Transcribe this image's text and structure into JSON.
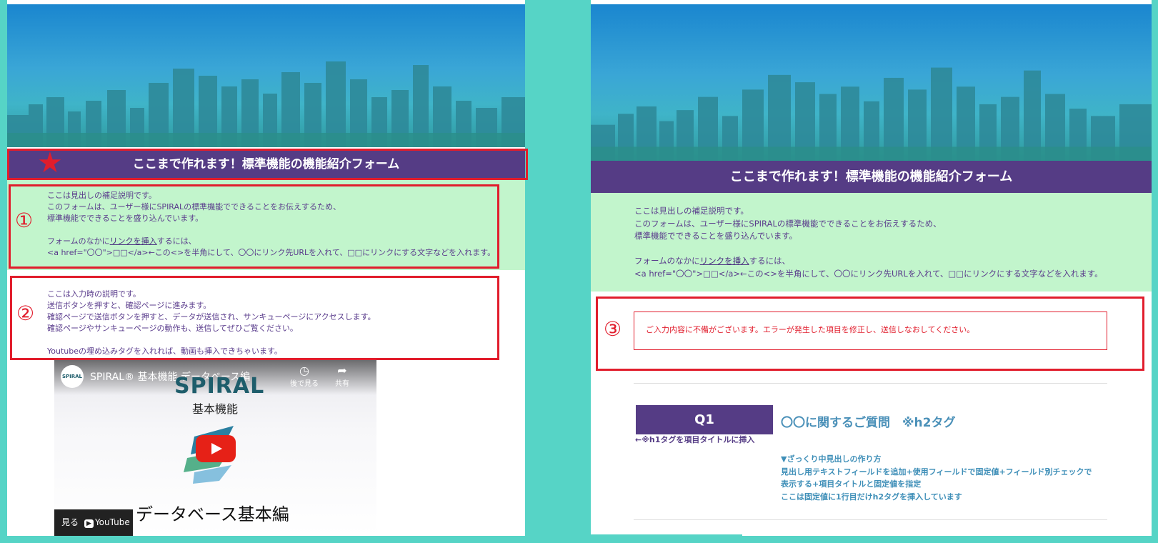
{
  "form_title": "ここまで作れます！標準機能の機能紹介フォーム",
  "description": {
    "lines": [
      "ここは見出しの補足説明です。",
      "このフォームは、ユーザー様にSPIRALの標準機能でできることをお伝えするため、",
      "標準機能でできることを盛り込んでいます。",
      "",
      "<a href=\"〇〇\">□□</a>←この<>を半角にして、〇〇にリンク先URLを入れて、□□にリンクにする文字などを入れます。"
    ],
    "link_line_prefix": "フォームのなかに",
    "link_text": "リンクを挿入",
    "link_line_suffix": "するには、"
  },
  "input_note": {
    "lines": [
      "ここは入力時の説明です。",
      "送信ボタンを押すと、確認ページに進みます。",
      "確認ページで送信ボタンを押すと、データが送信され、サンキューページにアクセスします。",
      "確認ページやサンキューページの動作も、送信してぜひご覧ください。",
      "",
      "Youtubeの埋め込みタグを入れれば、動画も挿入できちゃいます。"
    ]
  },
  "video": {
    "channel_avatar": "SPIRAL",
    "title": "SPIRAL® 基本機能 データベース編",
    "watch_later": "後で見る",
    "share": "共有",
    "logo_text": "SPIRAL",
    "subtitle": "基本機能",
    "main_caption": "データベース基本編",
    "watch_label": "見る",
    "youtube_label": "YouTube"
  },
  "annotations": {
    "marker_1": "①",
    "marker_2": "②",
    "marker_3": "③",
    "star": "★"
  },
  "error_message": "ご入力内容に不備がございます。エラーが発生した項目を修正し、送信しなおしてください。",
  "question": {
    "label": "Q1",
    "note": "←※h1タグを項目タイトルに挿入",
    "title": "〇〇に関するご質問　※h2タグ",
    "guide_lines": [
      "▼ざっくり中見出しの作り方",
      "見出し用テキストフィールドを追加+使用フィールドで固定値+フィールド別チェックで",
      "表示する+項目タイトルと固定値を指定",
      "ここは固定値に1行目だけh2タグを挿入しています"
    ]
  },
  "colors": {
    "background": "#56d4c6",
    "title_bar": "#553c85",
    "description_bg": "#c2f5cc",
    "annotation_red": "#e11d2c",
    "question_blue": "#4a90b8"
  },
  "icons": {
    "watch_later": "clock-icon",
    "share": "share-arrow-icon",
    "play": "youtube-play-icon",
    "star": "star-icon"
  }
}
